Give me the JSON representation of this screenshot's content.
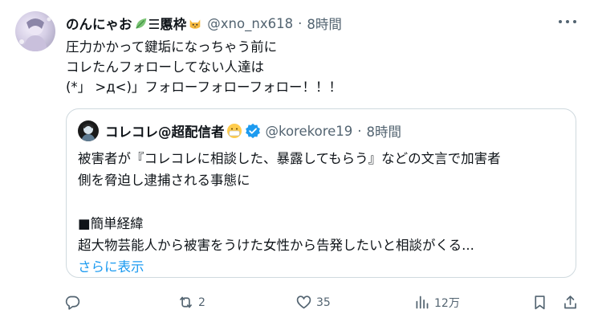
{
  "tweet": {
    "author_name": "のんにゃお",
    "author_name_suffix": "☰慝枠",
    "handle": "@xno_nx618",
    "separator": "·",
    "time": "8時間",
    "text_lines": [
      "圧力かかって鍵垢になっちゃう前に",
      "コレたんフォローしてない人達は",
      "(*」 >д<)」フォローフォローフォロー！！！"
    ]
  },
  "quote": {
    "author_name": "コレコレ@超配信者",
    "handle": "@korekore19",
    "separator": "·",
    "time": "8時間",
    "text_lines": [
      "被害者が『コレコレに相談した、暴露してもらう』などの文言で加害者",
      "側を脅迫し逮捕される事態に",
      "",
      "■簡単経緯",
      "超大物芸能人から被害をうけた女性から告発したいと相談がくる..."
    ],
    "show_more": "さらに表示"
  },
  "actions": {
    "reply_count": "",
    "retweet_count": "2",
    "like_count": "35",
    "views_count": "12万"
  },
  "colors": {
    "text": "#0f1419",
    "secondary": "#536471",
    "link": "#1d9bf0",
    "border": "#cfd9de",
    "verified": "#1d9bf0"
  },
  "icons": [
    "more-icon",
    "leaf-emoji-icon",
    "cat-emoji-icon",
    "mask-emoji-icon",
    "verified-badge-icon",
    "reply-icon",
    "retweet-icon",
    "like-icon",
    "views-icon",
    "bookmark-icon",
    "share-icon"
  ]
}
